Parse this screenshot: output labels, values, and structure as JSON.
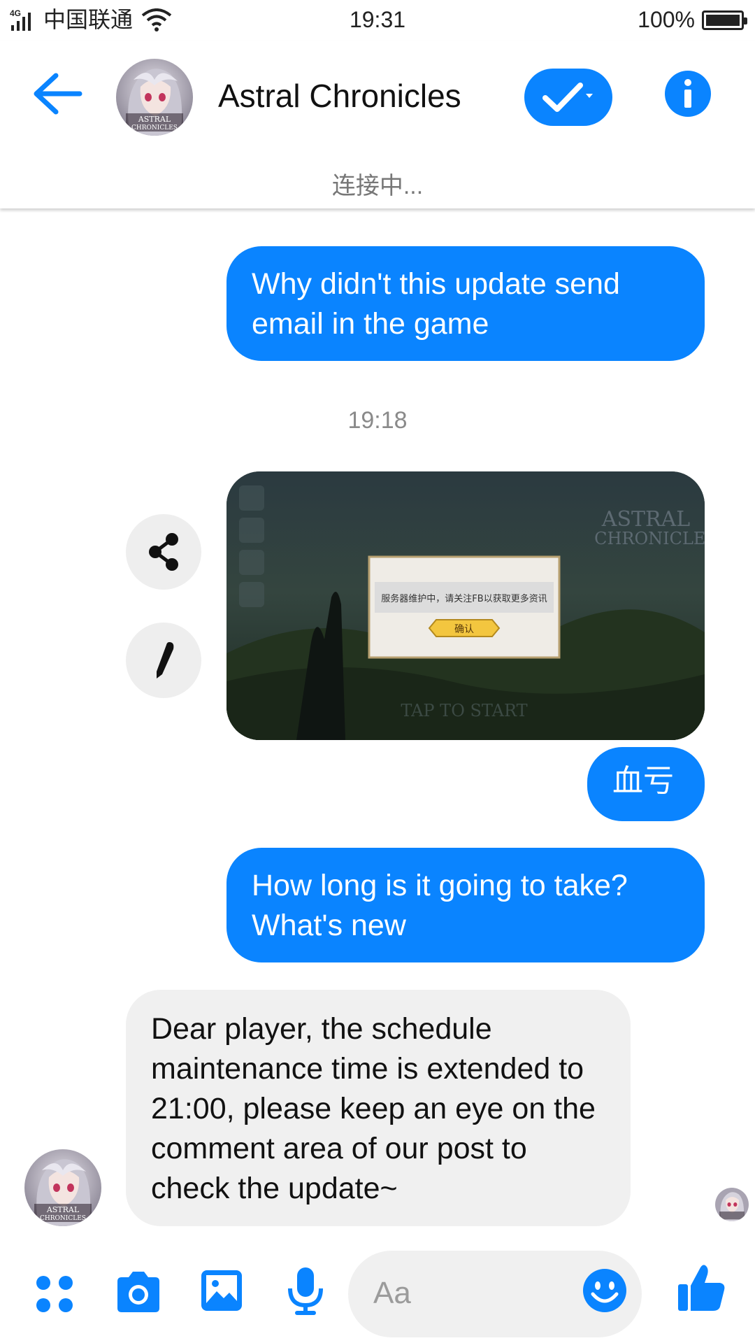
{
  "status_bar": {
    "network_type": "4G",
    "carrier": "中国联通",
    "time": "19:31",
    "battery_percent": "100%",
    "battery_level": 1.0
  },
  "header": {
    "title": "Astral Chronicles",
    "subtitle": "连接中...",
    "accent_color": "#0a84ff",
    "avatar_text_line1": "ASTRAL",
    "avatar_text_line2": "CHRONICLES"
  },
  "messages": {
    "msg1": "Why didn't this update send email in the game",
    "timestamp": "19:18",
    "image": {
      "logo_line1": "ASTRAL",
      "logo_line2": "CHRONICLES",
      "dialog_text": "服务器维护中，请关注FB以获取更多资讯",
      "dialog_button": "确认",
      "tap_to_start": "TAP TO START"
    },
    "msg2": "血亏",
    "msg3": "How long is it going to take? What's new",
    "reply": "Dear player, the schedule maintenance time is extended to 21:00, please keep an eye on the comment area of our post to check the update~"
  },
  "composer": {
    "placeholder": "Aa"
  },
  "icons": [
    "back-arrow-icon",
    "check-icon",
    "info-icon",
    "share-icon",
    "pencil-icon",
    "apps-icon",
    "camera-icon",
    "gallery-icon",
    "microphone-icon",
    "emoji-icon",
    "thumbs-up-icon"
  ]
}
